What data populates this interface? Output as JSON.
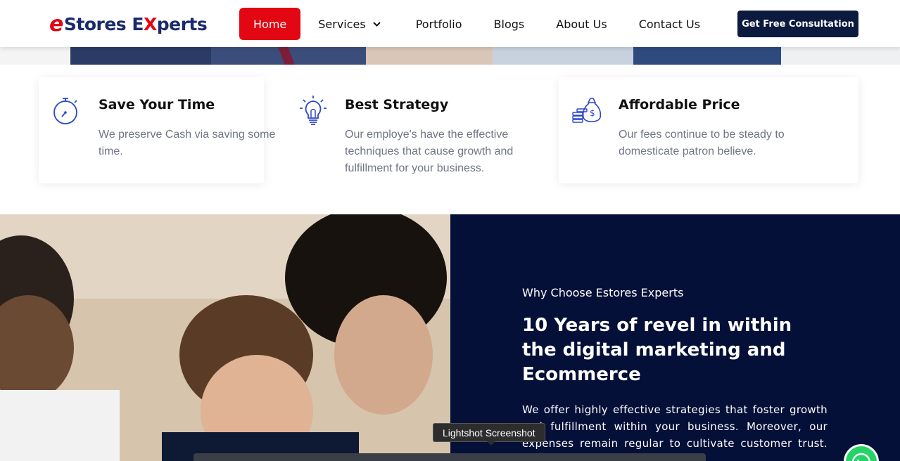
{
  "brand": {
    "prefix": "e",
    "part1": "Stores E",
    "x_letter": "X",
    "part2": "perts"
  },
  "nav": {
    "items": [
      {
        "label": "Home",
        "active": true
      },
      {
        "label": "Services",
        "has_dropdown": true
      },
      {
        "label": "Portfolio"
      },
      {
        "label": "Blogs"
      },
      {
        "label": "About Us"
      },
      {
        "label": "Contact Us"
      }
    ],
    "cta_label": "Get Free Consultation"
  },
  "features": [
    {
      "icon": "stopwatch-icon",
      "title": "Save Your Time",
      "desc": "We preserve Cash via saving some time."
    },
    {
      "icon": "lightbulb-icon",
      "title": "Best Strategy",
      "desc": "Our employe's have the effective techniques that cause growth and fulfillment for your business."
    },
    {
      "icon": "money-bag-icon",
      "title": "Affordable Price",
      "desc": "Our fees continue to be steady to domesticate patron believe."
    }
  ],
  "why": {
    "eyebrow": "Why Choose Estores Experts",
    "headline": "10 Years of revel in within the digital marketing and Ecommerce",
    "paragraph": "We offer highly effective strategies that foster growth and fulfillment within your business. Moreover, our expenses remain regular to cultivate customer trust. the fields of digital"
  },
  "overlay": {
    "tooltip": "Lightshot Screenshot"
  },
  "colors": {
    "accent": "#e30613",
    "navy": "#041038",
    "brand_blue": "#1a2a6c",
    "whatsapp": "#25d366"
  }
}
